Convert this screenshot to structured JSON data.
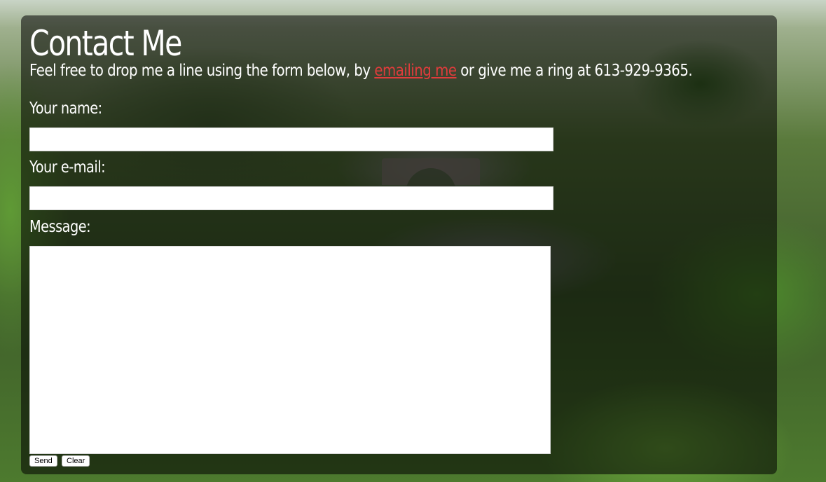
{
  "page": {
    "title": "Contact Me",
    "intro_before": "Feel free to drop me a line using the form below, by ",
    "intro_link": "emailing me",
    "intro_after": " or give me a ring at 613-929-9365."
  },
  "form": {
    "name_label": "Your name:",
    "name_value": "",
    "email_label": "Your e-mail:",
    "email_value": "",
    "message_label": "Message:",
    "message_value": "",
    "send_label": "Send",
    "clear_label": "Clear"
  },
  "colors": {
    "link": "#e03c3c",
    "panel_overlay": "rgba(0,0,0,0.55)",
    "text": "#ffffff"
  }
}
